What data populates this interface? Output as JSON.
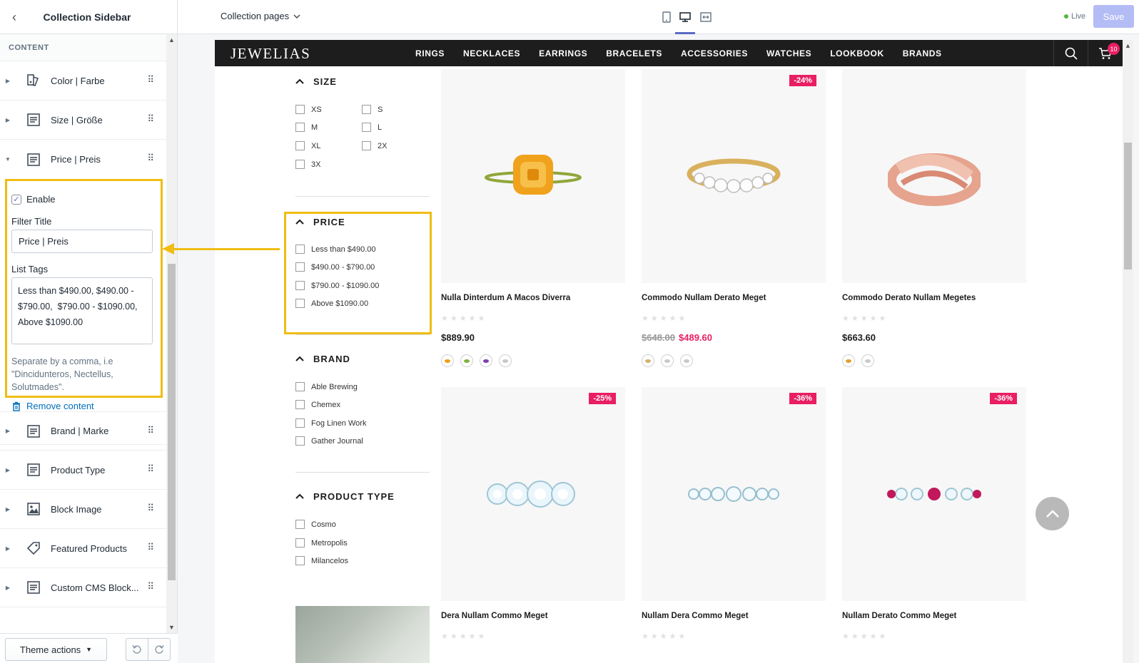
{
  "sidebar": {
    "title": "Collection Sidebar",
    "section_label": "CONTENT",
    "items_top": [
      {
        "label": "Color | Farbe",
        "icon": "palette-icon"
      },
      {
        "label": "Size | Größe",
        "icon": "text-block-icon"
      },
      {
        "label": "Price | Preis",
        "icon": "text-block-icon"
      }
    ],
    "editor": {
      "enable_label": "Enable",
      "enabled": true,
      "filter_title_label": "Filter Title",
      "filter_title_value": "Price | Preis",
      "list_tags_label": "List Tags",
      "list_tags_value": "Less than $490.00, $490.00 - $790.00,  $790.00 - $1090.00, Above $1090.00",
      "help_text": "Separate by a comma, i.e \"Dincidunteros, Nectellus, Solutmades\".",
      "remove_label": "Remove content"
    },
    "items_bottom": [
      {
        "label": "Brand | Marke",
        "icon": "text-block-icon"
      },
      {
        "label": "Product Type",
        "icon": "text-block-icon"
      },
      {
        "label": "Block Image",
        "icon": "image-icon"
      },
      {
        "label": "Featured Products",
        "icon": "tag-icon"
      },
      {
        "label": "Custom CMS Block...",
        "icon": "text-block-icon"
      }
    ],
    "theme_actions_label": "Theme actions"
  },
  "topbar": {
    "page_selector": "Collection pages",
    "live_label": "Live",
    "save_label": "Save"
  },
  "store": {
    "logo": "JEWELIAS",
    "nav": [
      "RINGS",
      "NECKLACES",
      "EARRINGS",
      "BRACELETS",
      "ACCESSORIES",
      "WATCHES",
      "LOOKBOOK",
      "BRANDS"
    ],
    "cart_count": "10"
  },
  "filters": {
    "size": {
      "title": "SIZE",
      "options": [
        "XS",
        "S",
        "M",
        "L",
        "XL",
        "2X",
        "3X"
      ]
    },
    "price": {
      "title": "PRICE",
      "options": [
        "Less than $490.00",
        "$490.00 - $790.00",
        "$790.00 - $1090.00",
        "Above $1090.00"
      ]
    },
    "brand": {
      "title": "BRAND",
      "options": [
        "Able Brewing",
        "Chemex",
        "Fog Linen Work",
        "Gather Journal"
      ]
    },
    "product_type": {
      "title": "PRODUCT TYPE",
      "options": [
        "Cosmo",
        "Metropolis",
        "Milancelos"
      ]
    }
  },
  "products": [
    {
      "name": "Nulla Dinterdum A Macos Diverra",
      "price": "$889.90",
      "old_price": "",
      "badge": "",
      "swatches": [
        "#f39c12",
        "#7cb342",
        "#7b3fb0",
        "#c7c7c7"
      ]
    },
    {
      "name": "Commodo Nullam Derato Meget",
      "price": "$489.60",
      "old_price": "$648.00",
      "badge": "-24%",
      "swatches": [
        "#d4b26a",
        "#c9c9c9",
        "#c9c9c9"
      ]
    },
    {
      "name": "Commodo Derato Nullam Megetes",
      "price": "$663.60",
      "old_price": "",
      "badge": "",
      "swatches": [
        "#e0a030",
        "#c9c9c9"
      ]
    },
    {
      "name": "Dera Nullam Commo Meget",
      "badge": "-25%"
    },
    {
      "name": "Nullam Dera Commo Meget",
      "badge": "-36%"
    },
    {
      "name": "Nullam Derato Commo Meget",
      "badge": "-36%"
    }
  ],
  "colors": {
    "accent": "#5c6ac4",
    "highlight": "#f0bd14",
    "sale": "#e91e63",
    "nav_bg": "#1d1d1d"
  }
}
